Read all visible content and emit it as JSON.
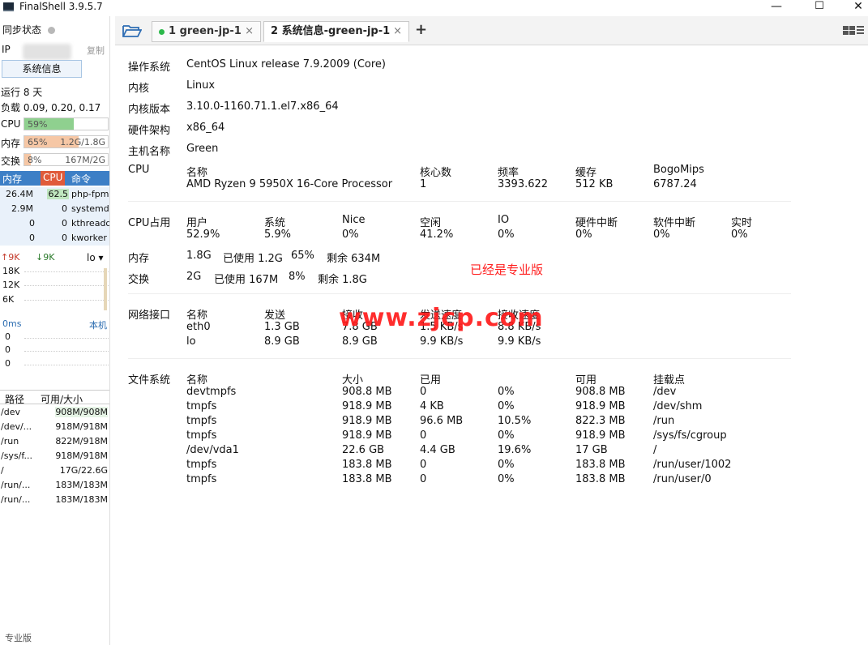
{
  "window": {
    "title": "FinalShell 3.9.5.7",
    "min": "—",
    "max": "☐",
    "close": "✕"
  },
  "sidebar": {
    "sync_label": "同步状态",
    "ip_label": "IP",
    "copy_label": "复制",
    "sysinfo_button": "系统信息",
    "uptime": "运行 8 天",
    "load": "负载 0.09, 0.20, 0.17",
    "cpu": {
      "label": "CPU",
      "value": "59%",
      "fraction": 0.59,
      "color": "#8fd08f"
    },
    "mem": {
      "label": "内存",
      "value": "65%",
      "detail": "1.2G/1.8G",
      "fraction": 0.65,
      "color": "#f6c7a5"
    },
    "swap": {
      "label": "交换",
      "value": "8%",
      "detail": "167M/2G",
      "fraction": 0.08,
      "color": "#f6c7a5"
    },
    "proc_headers": [
      "内存",
      "CPU",
      "命令"
    ],
    "processes": [
      {
        "mem": "26.4M",
        "cpu": "62.5",
        "cmd": "php-fpm"
      },
      {
        "mem": "2.9M",
        "cpu": "0",
        "cmd": "systemd"
      },
      {
        "mem": "0",
        "cpu": "0",
        "cmd": "kthreadd"
      },
      {
        "mem": "0",
        "cpu": "0",
        "cmd": "kworker"
      }
    ],
    "net": {
      "up": "↑9K",
      "down": "↓9K",
      "iface": "lo ▾",
      "ticks": [
        "18K",
        "12K",
        "6K"
      ]
    },
    "latency": {
      "label": "0ms",
      "host": "本机",
      "ticks": [
        "0",
        "0",
        "0"
      ]
    },
    "fs_headers": [
      "路径",
      "可用/大小"
    ],
    "fs": [
      {
        "path": "/dev",
        "size": "908M/908M"
      },
      {
        "path": "/dev/...",
        "size": "918M/918M"
      },
      {
        "path": "/run",
        "size": "822M/918M"
      },
      {
        "path": "/sys/f...",
        "size": "918M/918M"
      },
      {
        "path": "/",
        "size": "17G/22.6G"
      },
      {
        "path": "/run/...",
        "size": "183M/183M"
      },
      {
        "path": "/run/...",
        "size": "183M/183M"
      }
    ],
    "edition": "专业版"
  },
  "tabs": [
    {
      "label": "1 green-jp-1",
      "close": "×"
    },
    {
      "label": "2 系统信息-green-jp-1",
      "close": "×"
    }
  ],
  "add_tab": "+",
  "info": {
    "os_label": "操作系统",
    "os": "CentOS Linux release 7.9.2009 (Core)",
    "kernel_label": "内核",
    "kernel": "Linux",
    "kver_label": "内核版本",
    "kver": "3.10.0-1160.71.1.el7.x86_64",
    "arch_label": "硬件架构",
    "arch": "x86_64",
    "host_label": "主机名称",
    "host": "Green",
    "cpu_label": "CPU",
    "cpu_headers": [
      "名称",
      "核心数",
      "频率",
      "缓存",
      "BogoMips"
    ],
    "cpu_values": [
      "AMD Ryzen 9 5950X 16-Core Processor",
      "1",
      "3393.622",
      "512 KB",
      "6787.24"
    ],
    "cpuuse_label": "CPU占用",
    "cpuuse_headers": [
      "用户",
      "系统",
      "Nice",
      "空闲",
      "IO",
      "硬件中断",
      "软件中断",
      "实时"
    ],
    "cpuuse_values": [
      "52.9%",
      "5.9%",
      "0%",
      "41.2%",
      "0%",
      "0%",
      "0%",
      "0%"
    ],
    "mem_label": "内存",
    "mem_values": [
      "1.8G",
      "已使用 1.2G",
      "65%",
      "剩余 634M"
    ],
    "swap_label": "交换",
    "swap_values": [
      "2G",
      "已使用 167M",
      "8%",
      "剩余 1.8G"
    ],
    "pro_note": "已经是专业版",
    "net_label": "网络接口",
    "net_headers": [
      "名称",
      "发送",
      "接收",
      "发送速度",
      "接收速度"
    ],
    "net_rows": [
      [
        "eth0",
        "1.3 GB",
        "7.8 GB",
        "1.5 KB/s",
        "8.8 KB/s"
      ],
      [
        "lo",
        "8.9 GB",
        "8.9 GB",
        "9.9 KB/s",
        "9.9 KB/s"
      ]
    ],
    "fs_label": "文件系统",
    "fs_headers": [
      "名称",
      "大小",
      "已用",
      "",
      "可用",
      "挂载点"
    ],
    "fs_rows": [
      [
        "devtmpfs",
        "908.8 MB",
        "0",
        "0%",
        "908.8 MB",
        "/dev"
      ],
      [
        "tmpfs",
        "918.9 MB",
        "4 KB",
        "0%",
        "918.9 MB",
        "/dev/shm"
      ],
      [
        "tmpfs",
        "918.9 MB",
        "96.6 MB",
        "10.5%",
        "822.3 MB",
        "/run"
      ],
      [
        "tmpfs",
        "918.9 MB",
        "0",
        "0%",
        "918.9 MB",
        "/sys/fs/cgroup"
      ],
      [
        "/dev/vda1",
        "22.6 GB",
        "4.4 GB",
        "19.6%",
        "17 GB",
        "/"
      ],
      [
        "tmpfs",
        "183.8 MB",
        "0",
        "0%",
        "183.8 MB",
        "/run/user/1002"
      ],
      [
        "tmpfs",
        "183.8 MB",
        "0",
        "0%",
        "183.8 MB",
        "/run/user/0"
      ]
    ]
  },
  "watermark": "www.zjcp.com"
}
